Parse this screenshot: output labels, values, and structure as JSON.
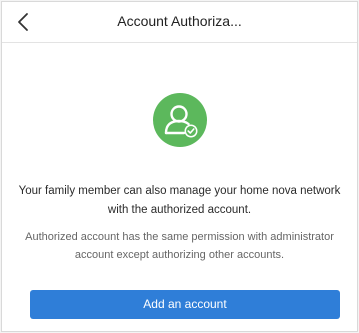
{
  "header": {
    "title": "Account Authoriza..."
  },
  "icons": {
    "back": "chevron-left-icon",
    "hero": "user-check-icon"
  },
  "main": {
    "description": "Your family member can also manage your home nova network with the authorized account.",
    "note": "Authorized account has the same permission with administrator account except authorizing other accounts."
  },
  "actions": {
    "add_account_label": "Add an account"
  },
  "colors": {
    "accent": "#2f7ed8",
    "hero_green": "#5cb85c"
  }
}
